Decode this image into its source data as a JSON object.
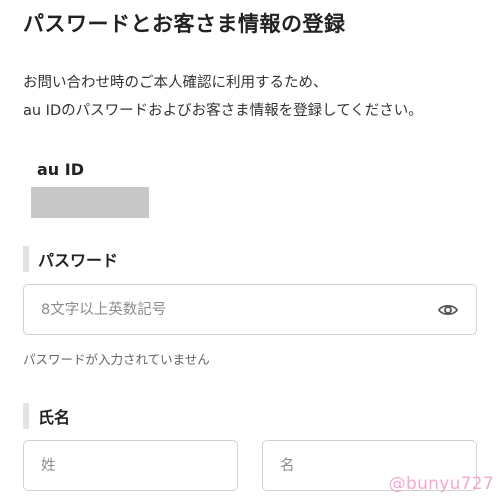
{
  "page": {
    "title": "パスワードとお客さま情報の登録",
    "intro_line1": "お問い合わせ時のご本人確認に利用するため、",
    "intro_line2": "au IDのパスワードおよびお客さま情報を登録してください。"
  },
  "au_id": {
    "label": "au ID"
  },
  "password_section": {
    "label": "パスワード",
    "placeholder": "8文字以上英数記号",
    "value": "",
    "toggle_icon": "eye-icon",
    "error": "パスワードが入力されていません"
  },
  "name_section": {
    "label": "氏名",
    "last_name_placeholder": "姓",
    "first_name_placeholder": "名"
  },
  "watermark": "@bunyu727",
  "colors": {
    "section_bar": "#e3e3e3",
    "field_border": "#d2d2d2",
    "masked_id": "#c8c8c8",
    "watermark": "#f4a8cf"
  }
}
